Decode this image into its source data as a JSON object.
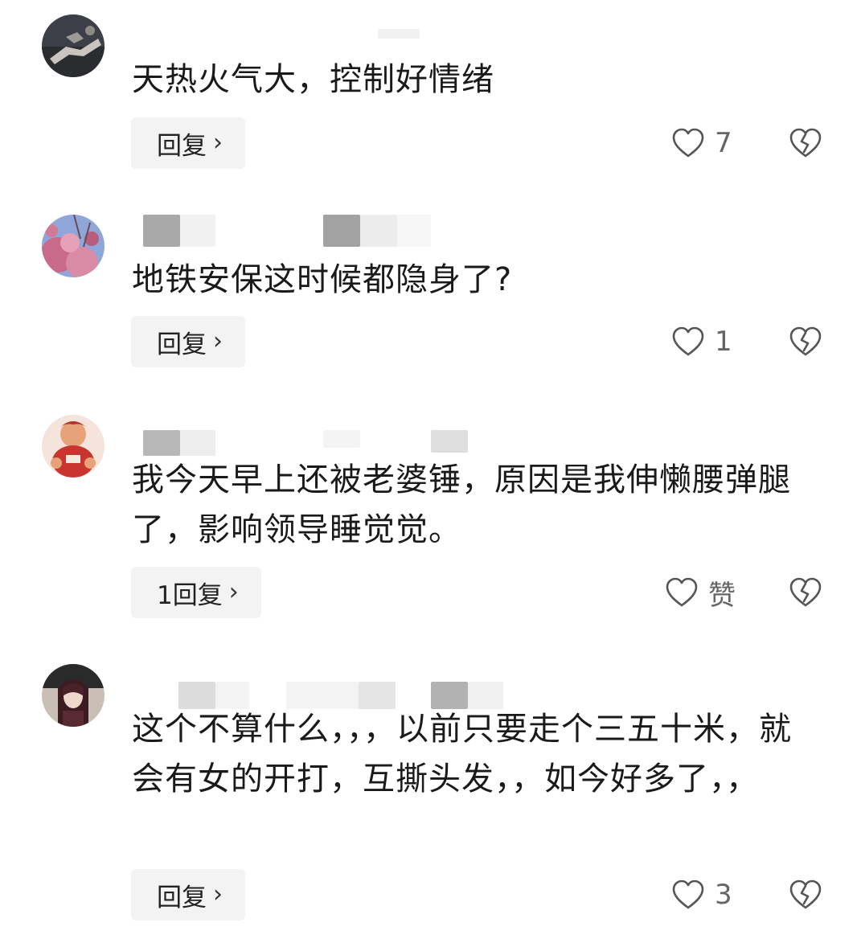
{
  "comments": [
    {
      "text": "天热火气大，控制好情绪",
      "reply_label": "回复",
      "like_count": "7",
      "avatar": "avatar-dark-photo"
    },
    {
      "text": "地铁安保这时候都隐身了?",
      "reply_label": "回复",
      "like_count": "1",
      "avatar": "avatar-pink-flowers"
    },
    {
      "text": "我今天早上还被老婆锤，原因是我伸懒腰弹腿了，影响领导睡觉觉。",
      "reply_label": "1回复",
      "like_count": "赞",
      "avatar": "avatar-cartoon-player"
    },
    {
      "text": "这个不算什么，，，以前只要走个三五十米，就会有女的开打，互撕头发，，如今好多了，，",
      "reply_label": "回复",
      "like_count": "3",
      "avatar": "avatar-anime-girl"
    }
  ],
  "icons": {
    "reply_chevron": "chevron-right-icon",
    "like": "heart-outline-icon",
    "dislike": "broken-heart-icon"
  },
  "colors": {
    "text": "#1a1a1a",
    "reply_bg": "#f3f3f3",
    "icon": "#555555",
    "count": "#666666"
  }
}
